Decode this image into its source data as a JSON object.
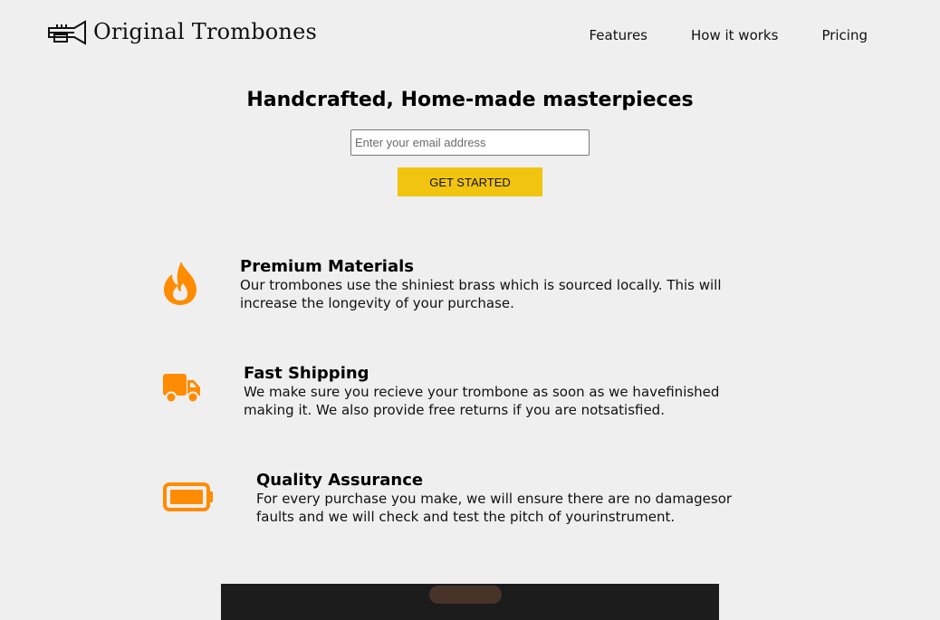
{
  "header": {
    "brand": "Original Trombones",
    "nav": [
      {
        "label": "Features"
      },
      {
        "label": "How it works"
      },
      {
        "label": "Pricing"
      }
    ]
  },
  "hero": {
    "title": "Handcrafted, Home-made masterpieces",
    "email_placeholder": "Enter your email address",
    "email_value": "",
    "cta_label": "GET STARTED"
  },
  "features": [
    {
      "icon": "fire-icon",
      "title": "Premium Materials",
      "description": "Our trombones use the shiniest brass which is sourced locally. This will increase the longevity of your purchase."
    },
    {
      "icon": "truck-icon",
      "title": "Fast Shipping",
      "description": "We make sure you recieve your trombone as soon as we havefinished making it. We also provide free returns if you are notsatisfied."
    },
    {
      "icon": "battery-icon",
      "title": "Quality Assurance",
      "description": "For every purchase you make, we will ensure there are no damagesor faults and we will check and test the pitch of yourinstrument."
    }
  ],
  "colors": {
    "background": "#efefef",
    "accent": "#f1c40f",
    "icon": "#ff8c00"
  }
}
